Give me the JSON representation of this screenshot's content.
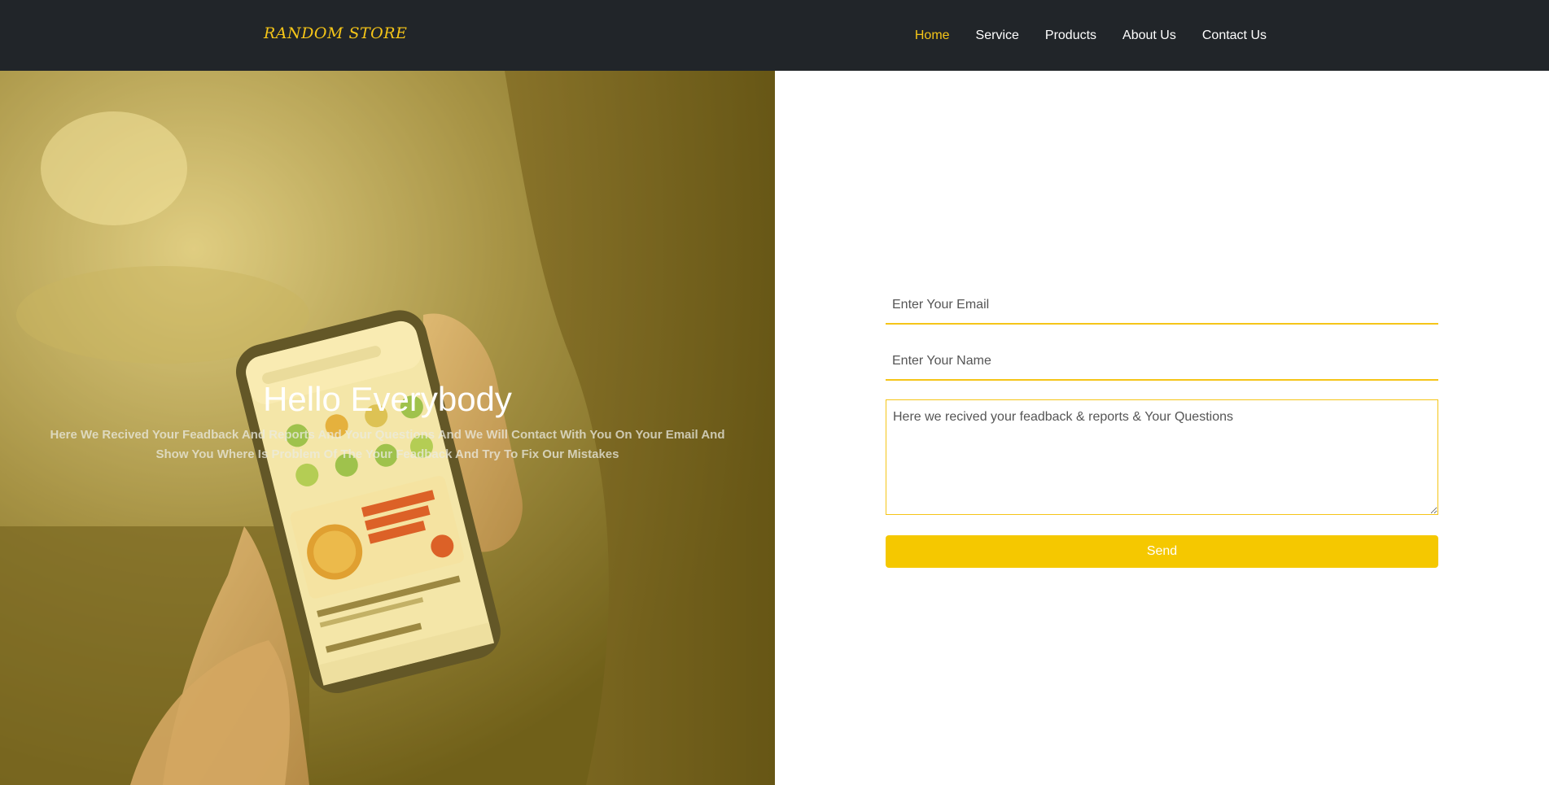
{
  "brand": {
    "name": "RANDOM STORE",
    "color": "#f5c518"
  },
  "nav": {
    "items": [
      {
        "label": "Home",
        "active": true
      },
      {
        "label": "Service",
        "active": false
      },
      {
        "label": "Products",
        "active": false
      },
      {
        "label": "About Us",
        "active": false
      },
      {
        "label": "Contact Us",
        "active": false
      }
    ]
  },
  "hero": {
    "title": "Hello Everybody",
    "text": "Here We Recived Your Feadback And Reports And Your Questions And We Will Contact With You On Your Email And Show You Where Is Problem Of The Your Feadback And Try To Fix Our Mistakes",
    "image": "hand-holding-smartphone-photo"
  },
  "form": {
    "email_placeholder": "Enter Your Email",
    "name_placeholder": "Enter Your Name",
    "message_placeholder": "Here we recived your feadback & reports & Your Questions",
    "send_label": "Send"
  },
  "colors": {
    "navbar_bg": "#212529",
    "accent": "#f5c518",
    "button_bg": "#f5c800"
  }
}
